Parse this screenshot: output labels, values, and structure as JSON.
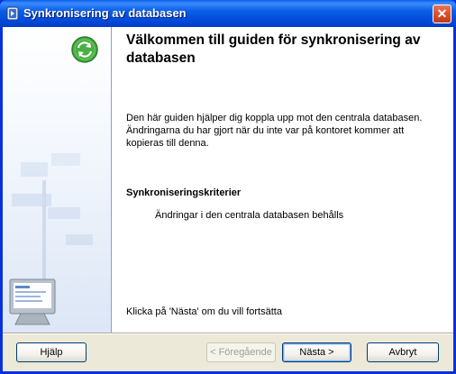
{
  "window": {
    "title": "Synkronisering av databasen",
    "close_glyph": "✕"
  },
  "wizard": {
    "heading": "Välkommen till guiden för synkronisering av databasen",
    "description": "Den här guiden hjälper dig koppla upp mot den centrala databasen. Ändringarna du har gjort när du inte var på kontoret kommer att kopieras till denna.",
    "criteria_title": "Synkroniseringskriterier",
    "criteria_item": "Ändringar i den centrala databasen behålls",
    "footer_hint": "Klicka på 'Nästa' om du vill fortsätta"
  },
  "buttons": {
    "help": "Hjälp",
    "previous": "< Föregående",
    "next": "Nästa >",
    "cancel": "Avbryt"
  },
  "icons": {
    "title_icon": "database-icon",
    "sync_icon": "sync-arrows-icon",
    "side_art": "signpost-and-monitor-illustration"
  },
  "colors": {
    "titlebar": "#0a5fe6",
    "sync_green": "#3ea63a",
    "dialog_bg": "#ece9d8"
  }
}
